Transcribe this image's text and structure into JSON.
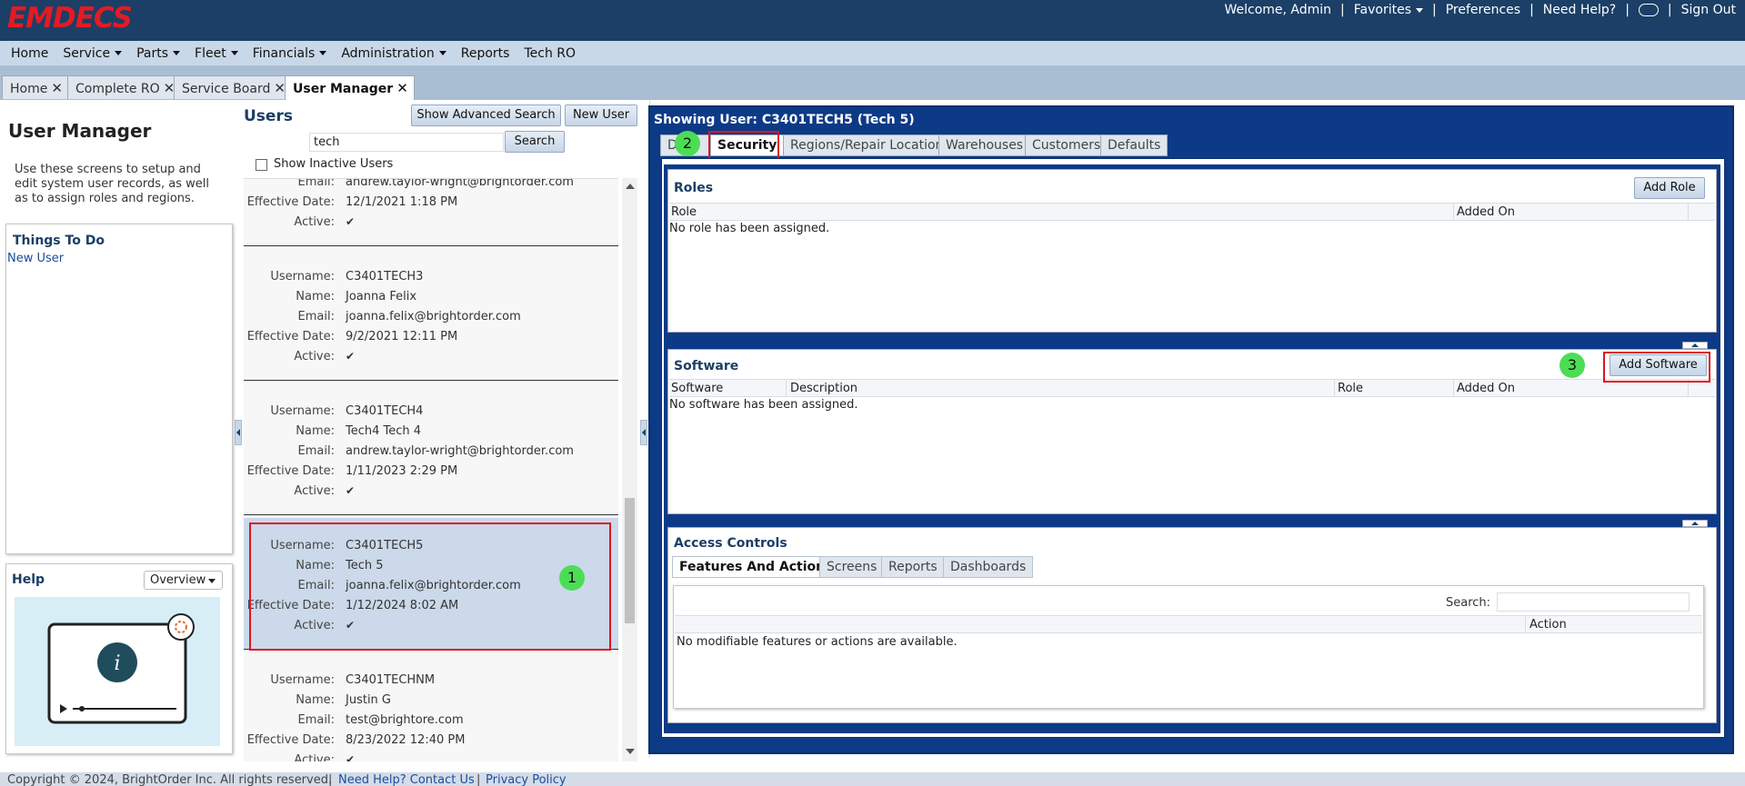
{
  "header": {
    "logo": "EMDECS",
    "welcome": "Welcome, Admin",
    "favorites": "Favorites",
    "preferences": "Preferences",
    "need_help": "Need Help?",
    "sign_out": "Sign Out"
  },
  "menu": [
    "Home",
    "Service",
    "Parts",
    "Fleet",
    "Financials",
    "Administration",
    "Reports",
    "Tech RO"
  ],
  "doc_tabs": [
    "Home",
    "Complete RO",
    "Service Board",
    "User Manager"
  ],
  "left": {
    "title": "User Manager",
    "description": "Use these screens to setup and edit system user records, as well as to assign roles and regions.",
    "todo_title": "Things To Do",
    "todo_link": "New User",
    "help_title": "Help",
    "help_select": "Overview"
  },
  "users": {
    "title": "Users",
    "advanced_search": "Show Advanced Search",
    "new_user": "New User",
    "search_value": "tech",
    "search_button": "Search",
    "show_inactive": "Show Inactive Users",
    "labels": {
      "username": "Username:",
      "name": "Name:",
      "email": "Email:",
      "effective": "Effective Date:",
      "active": "Active:"
    },
    "active_mark": "✔",
    "partial": {
      "email": "andrew.taylor-wright@brightorder.com",
      "effective": "12/1/2021 1:18 PM"
    },
    "cards": [
      {
        "username": "C3401TECH3",
        "name": "Joanna Felix",
        "email": "joanna.felix@brightorder.com",
        "effective": "9/2/2021 12:11 PM"
      },
      {
        "username": "C3401TECH4",
        "name": "Tech4 Tech 4",
        "email": "andrew.taylor-wright@brightorder.com",
        "effective": "1/11/2023 2:29 PM"
      },
      {
        "username": "C3401TECH5",
        "name": "Tech 5",
        "email": "joanna.felix@brightorder.com",
        "effective": "1/12/2024 8:02 AM"
      },
      {
        "username": "C3401TECHNM",
        "name": "Justin G",
        "email": "test@brightore.com",
        "effective": "8/23/2022 12:40 PM"
      }
    ]
  },
  "detail": {
    "showing": "Showing User: C3401TECH5 (Tech 5)",
    "tabs": [
      "De",
      "Security",
      "Regions/Repair Locations",
      "Warehouses",
      "Customers",
      "Defaults"
    ],
    "roles": {
      "title": "Roles",
      "add": "Add Role",
      "cols": [
        "Role",
        "Added On"
      ],
      "empty": "No role has been assigned."
    },
    "software": {
      "title": "Software",
      "add": "Add Software",
      "cols": [
        "Software",
        "Description",
        "Role",
        "Added On"
      ],
      "empty": "No software has been assigned."
    },
    "access": {
      "title": "Access Controls",
      "tabs": [
        "Features And Actions",
        "Screens",
        "Reports",
        "Dashboards"
      ],
      "search_label": "Search:",
      "col_action": "Action",
      "empty": "No modifiable features or actions are available."
    }
  },
  "badges": [
    "1",
    "2",
    "3"
  ],
  "footer": {
    "copyright": "Copyright © 2024, BrightOrder Inc. All rights reserved.",
    "contact": "Need Help? Contact Us",
    "privacy": "Privacy Policy"
  },
  "colors": {
    "header": "#1b3f66",
    "logo": "#e31b23",
    "panel_blue": "#0d3a86",
    "highlight": "#e0141e",
    "badge": "#4cdd55"
  }
}
